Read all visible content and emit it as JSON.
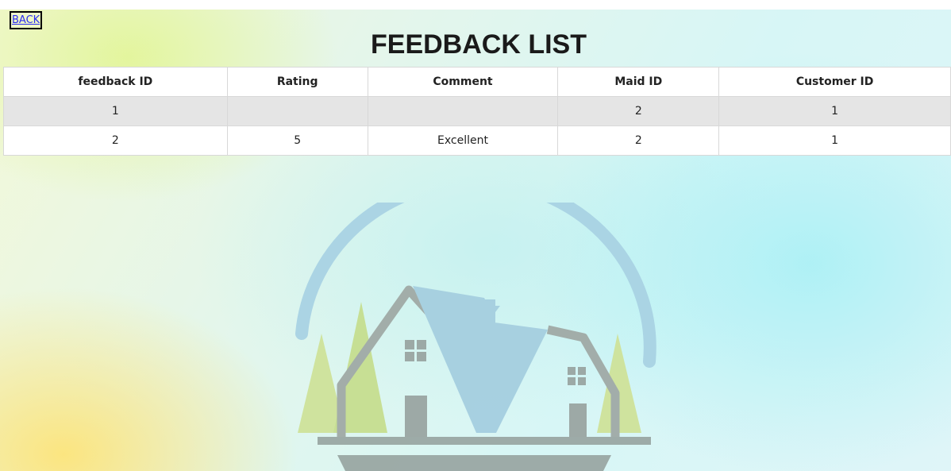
{
  "back_label": "BACK",
  "page_title": "FEEDBACK LIST",
  "table": {
    "headers": [
      "feedback ID",
      "Rating",
      "Comment",
      "Maid ID",
      "Customer ID"
    ],
    "rows": [
      [
        "1",
        "",
        "",
        "2",
        "1"
      ],
      [
        "2",
        "5",
        "Excellent",
        "2",
        "1"
      ]
    ]
  },
  "colors": {
    "link": "#2d2df0",
    "header_bg": "#ffffff",
    "odd_row_bg": "#e5e5e5",
    "logo_arc": "#9fcfe0",
    "logo_house": "#9aa8a4",
    "logo_trees": "#c3dc8e"
  }
}
